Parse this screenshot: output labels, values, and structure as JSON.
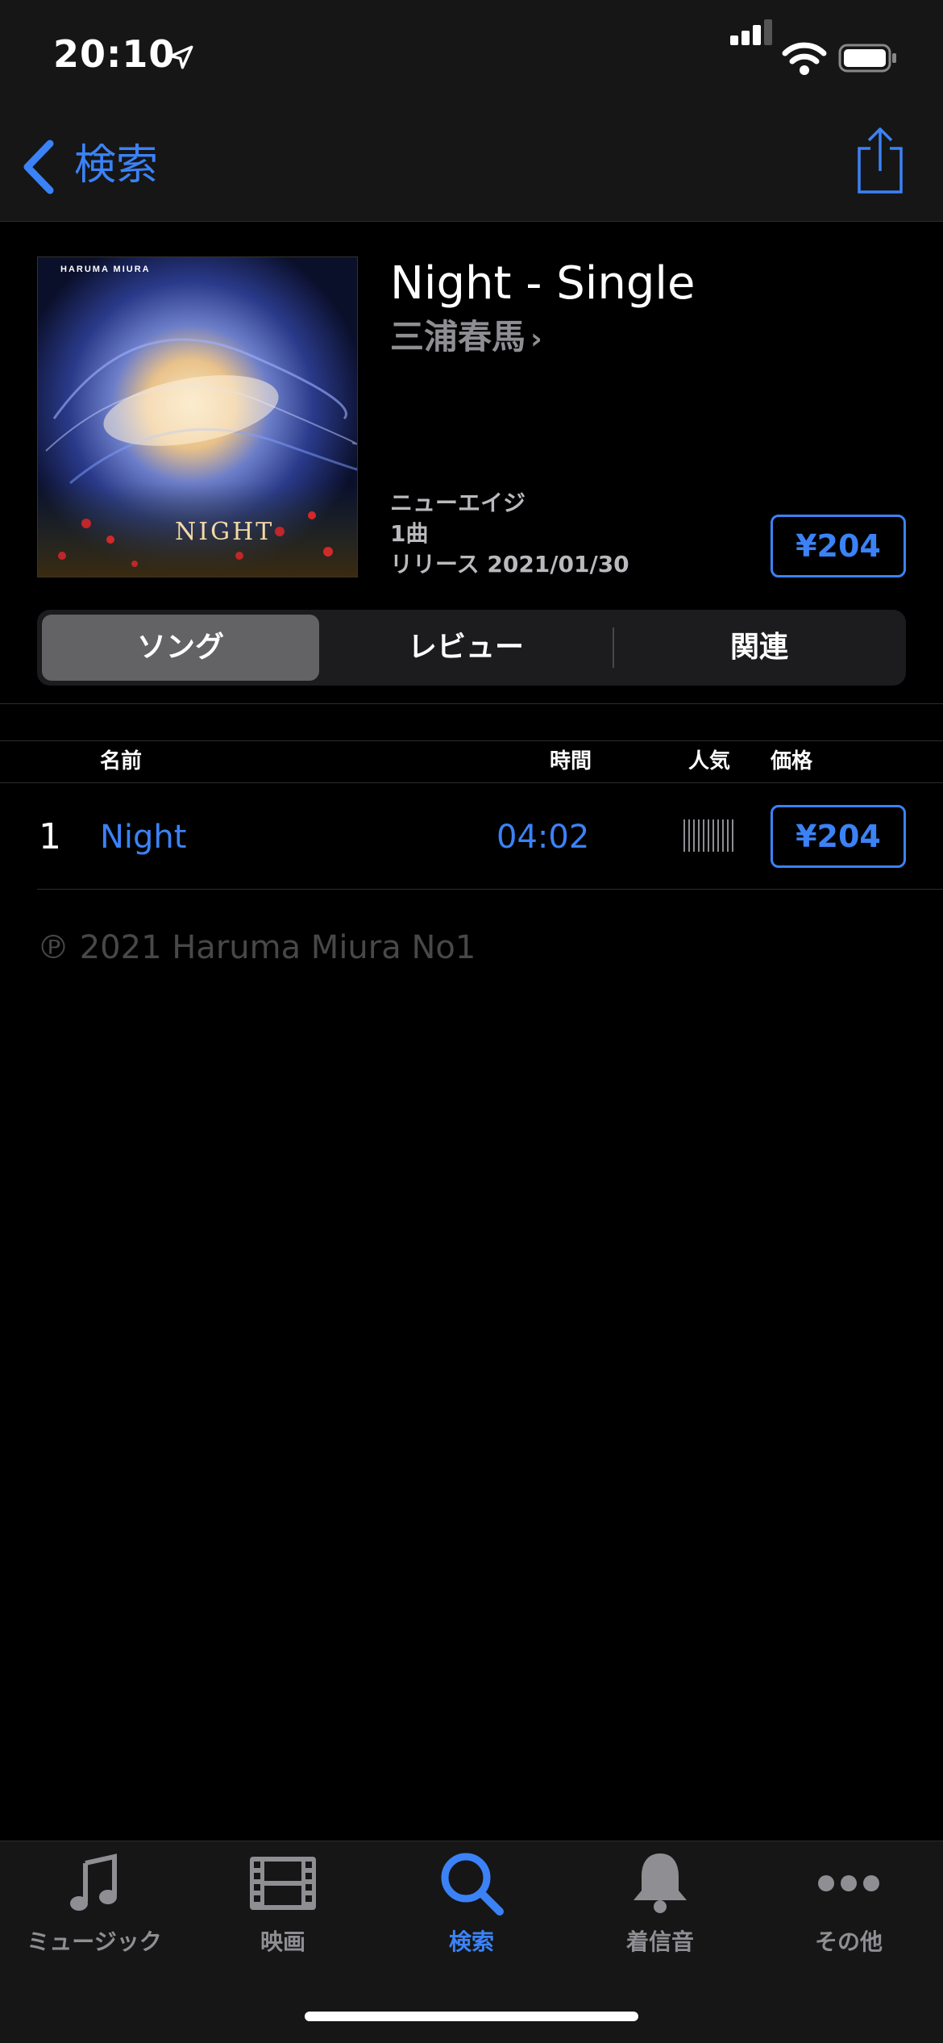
{
  "status_bar": {
    "time": "20:10"
  },
  "nav": {
    "back_label": "検索"
  },
  "album": {
    "title": "Night - Single",
    "artist": "三浦春馬",
    "genre": "ニューエイジ",
    "track_count": "1曲",
    "release": "リリース 2021/01/30",
    "price": "¥204",
    "artwork_text_top": "HARUMA MIURA",
    "artwork_text_bottom": "NIGHT"
  },
  "segments": [
    "ソング",
    "レビュー",
    "関連"
  ],
  "table": {
    "headers": {
      "name": "名前",
      "time": "時間",
      "popularity": "人気",
      "price": "価格"
    },
    "rows": [
      {
        "num": "1",
        "name": "Night",
        "duration": "04:02",
        "price": "¥204"
      }
    ]
  },
  "copyright": "℗ 2021 Haruma Miura No1",
  "tabs": [
    {
      "label": "ミュージック",
      "icon": "music-note-icon"
    },
    {
      "label": "映画",
      "icon": "film-icon"
    },
    {
      "label": "検索",
      "icon": "search-icon"
    },
    {
      "label": "着信音",
      "icon": "bell-icon"
    },
    {
      "label": "その他",
      "icon": "more-icon"
    }
  ],
  "colors": {
    "accent": "#3b82f6",
    "background": "#000000",
    "bar": "#161616"
  }
}
